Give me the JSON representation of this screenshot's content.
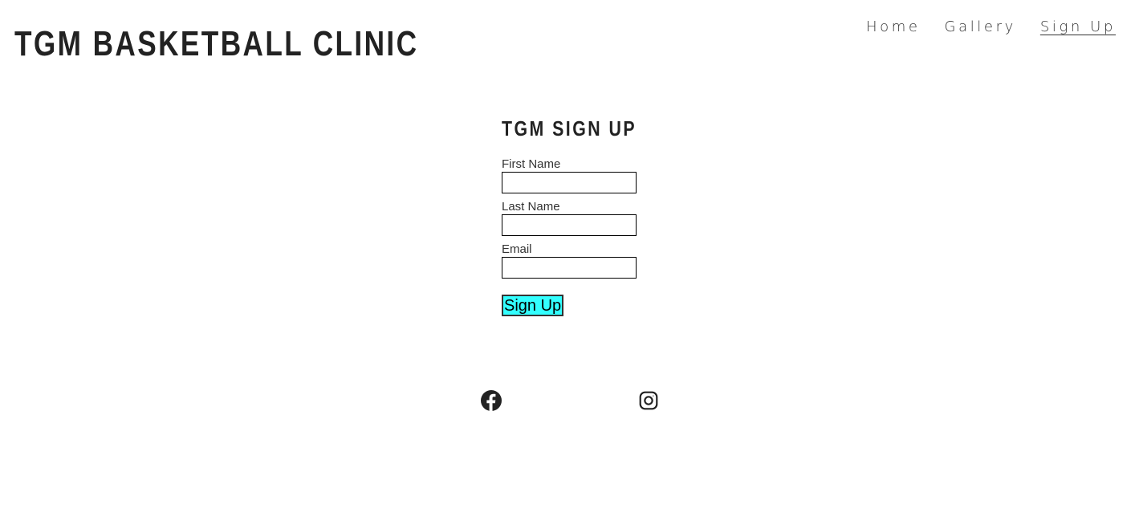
{
  "header": {
    "site_title": "TGM BASKETBALL CLINIC",
    "nav": [
      {
        "label": "Home",
        "active": false
      },
      {
        "label": "Gallery",
        "active": false
      },
      {
        "label": "Sign Up",
        "active": true
      }
    ]
  },
  "form": {
    "heading": "TGM SIGN UP",
    "fields": [
      {
        "label": "First Name",
        "value": ""
      },
      {
        "label": "Last Name",
        "value": ""
      },
      {
        "label": "Email",
        "value": ""
      }
    ],
    "submit_label": "Sign Up",
    "submit_color": "#33ffff"
  },
  "footer": {
    "social_icons": [
      "facebook-icon",
      "instagram-icon"
    ]
  }
}
